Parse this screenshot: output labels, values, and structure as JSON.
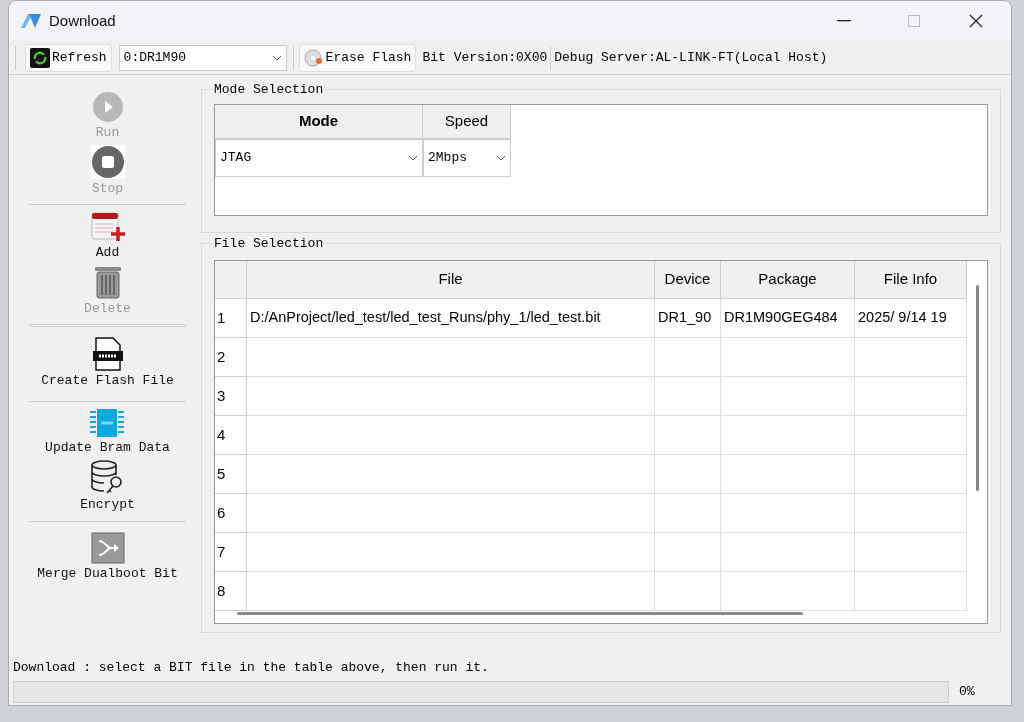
{
  "window": {
    "title": "Download"
  },
  "toolbar": {
    "refresh": "Refresh",
    "device": "0:DR1M90",
    "erase": "Erase Flash",
    "bit_version": "Bit Version:0X00",
    "debug_server": "Debug Server:AL-LINK-FT(Local Host)"
  },
  "sidebar": {
    "groups": [
      [
        {
          "kind": "run",
          "label": "Run",
          "disabled": true
        },
        {
          "kind": "stop",
          "label": "Stop",
          "disabled": true
        }
      ],
      [
        {
          "kind": "add",
          "label": "Add",
          "disabled": false
        },
        {
          "kind": "delete",
          "label": "Delete",
          "disabled": true
        }
      ],
      [
        {
          "kind": "flash",
          "label": "Create Flash File",
          "disabled": false
        }
      ],
      [
        {
          "kind": "bram",
          "label": "Update Bram Data",
          "disabled": false
        },
        {
          "kind": "encrypt",
          "label": "Encrypt",
          "disabled": false
        }
      ],
      [
        {
          "kind": "merge",
          "label": "Merge Dualboot Bit",
          "disabled": false
        }
      ]
    ]
  },
  "mode_selection": {
    "title": "Mode Selection",
    "columns": [
      "Mode",
      "Speed"
    ],
    "mode": "JTAG",
    "speed": "2Mbps"
  },
  "file_selection": {
    "title": "File Selection",
    "columns": [
      "File",
      "Device",
      "Package",
      "File Info"
    ],
    "rows": [
      {
        "number": "1",
        "cells": [
          "D:/AnProject/led_test/led_test_Runs/phy_1/led_test.bit",
          "DR1_90",
          "DR1M90GEG484",
          "2025/ 9/14 19"
        ]
      },
      {
        "number": "2",
        "cells": []
      },
      {
        "number": "3",
        "cells": []
      },
      {
        "number": "4",
        "cells": []
      },
      {
        "number": "5",
        "cells": []
      },
      {
        "number": "6",
        "cells": []
      },
      {
        "number": "7",
        "cells": []
      },
      {
        "number": "8",
        "cells": []
      }
    ]
  },
  "status": {
    "message": "Download : select a BIT file in the table above, then run it.",
    "progress": {
      "level": 0,
      "reading": "0%"
    }
  }
}
